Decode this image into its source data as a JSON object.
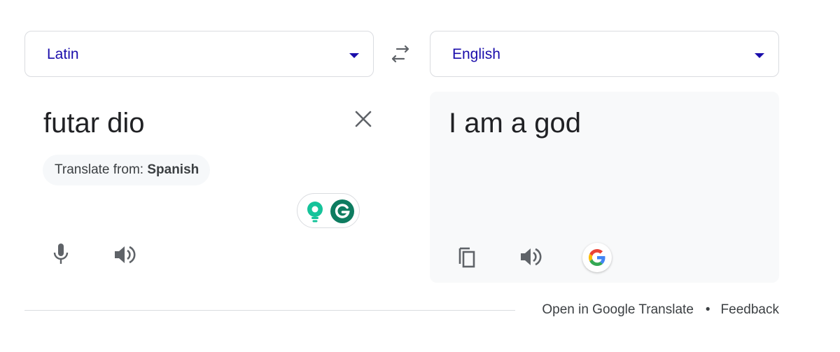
{
  "source": {
    "language": "Latin",
    "text": "futar dio",
    "detect_prefix": "Translate from: ",
    "detect_language": "Spanish"
  },
  "target": {
    "language": "English",
    "text": "I am a god"
  },
  "footer": {
    "open_link": "Open in Google Translate",
    "separator": "•",
    "feedback_link": "Feedback"
  },
  "colors": {
    "language_label": "#1a0dab",
    "target_panel_bg": "#f8f9fa",
    "grammarly_green": "#15c39a",
    "grammarly_dark": "#0e7c60",
    "icon_gray": "#5f6368"
  },
  "icons": {
    "swap": "swap-arrows-icon",
    "clear": "close-icon",
    "mic": "microphone-icon",
    "speaker": "speaker-icon",
    "copy": "copy-icon",
    "google": "google-g-icon",
    "grammarly_bulb": "lightbulb-icon",
    "grammarly_logo": "grammarly-logo-icon"
  }
}
